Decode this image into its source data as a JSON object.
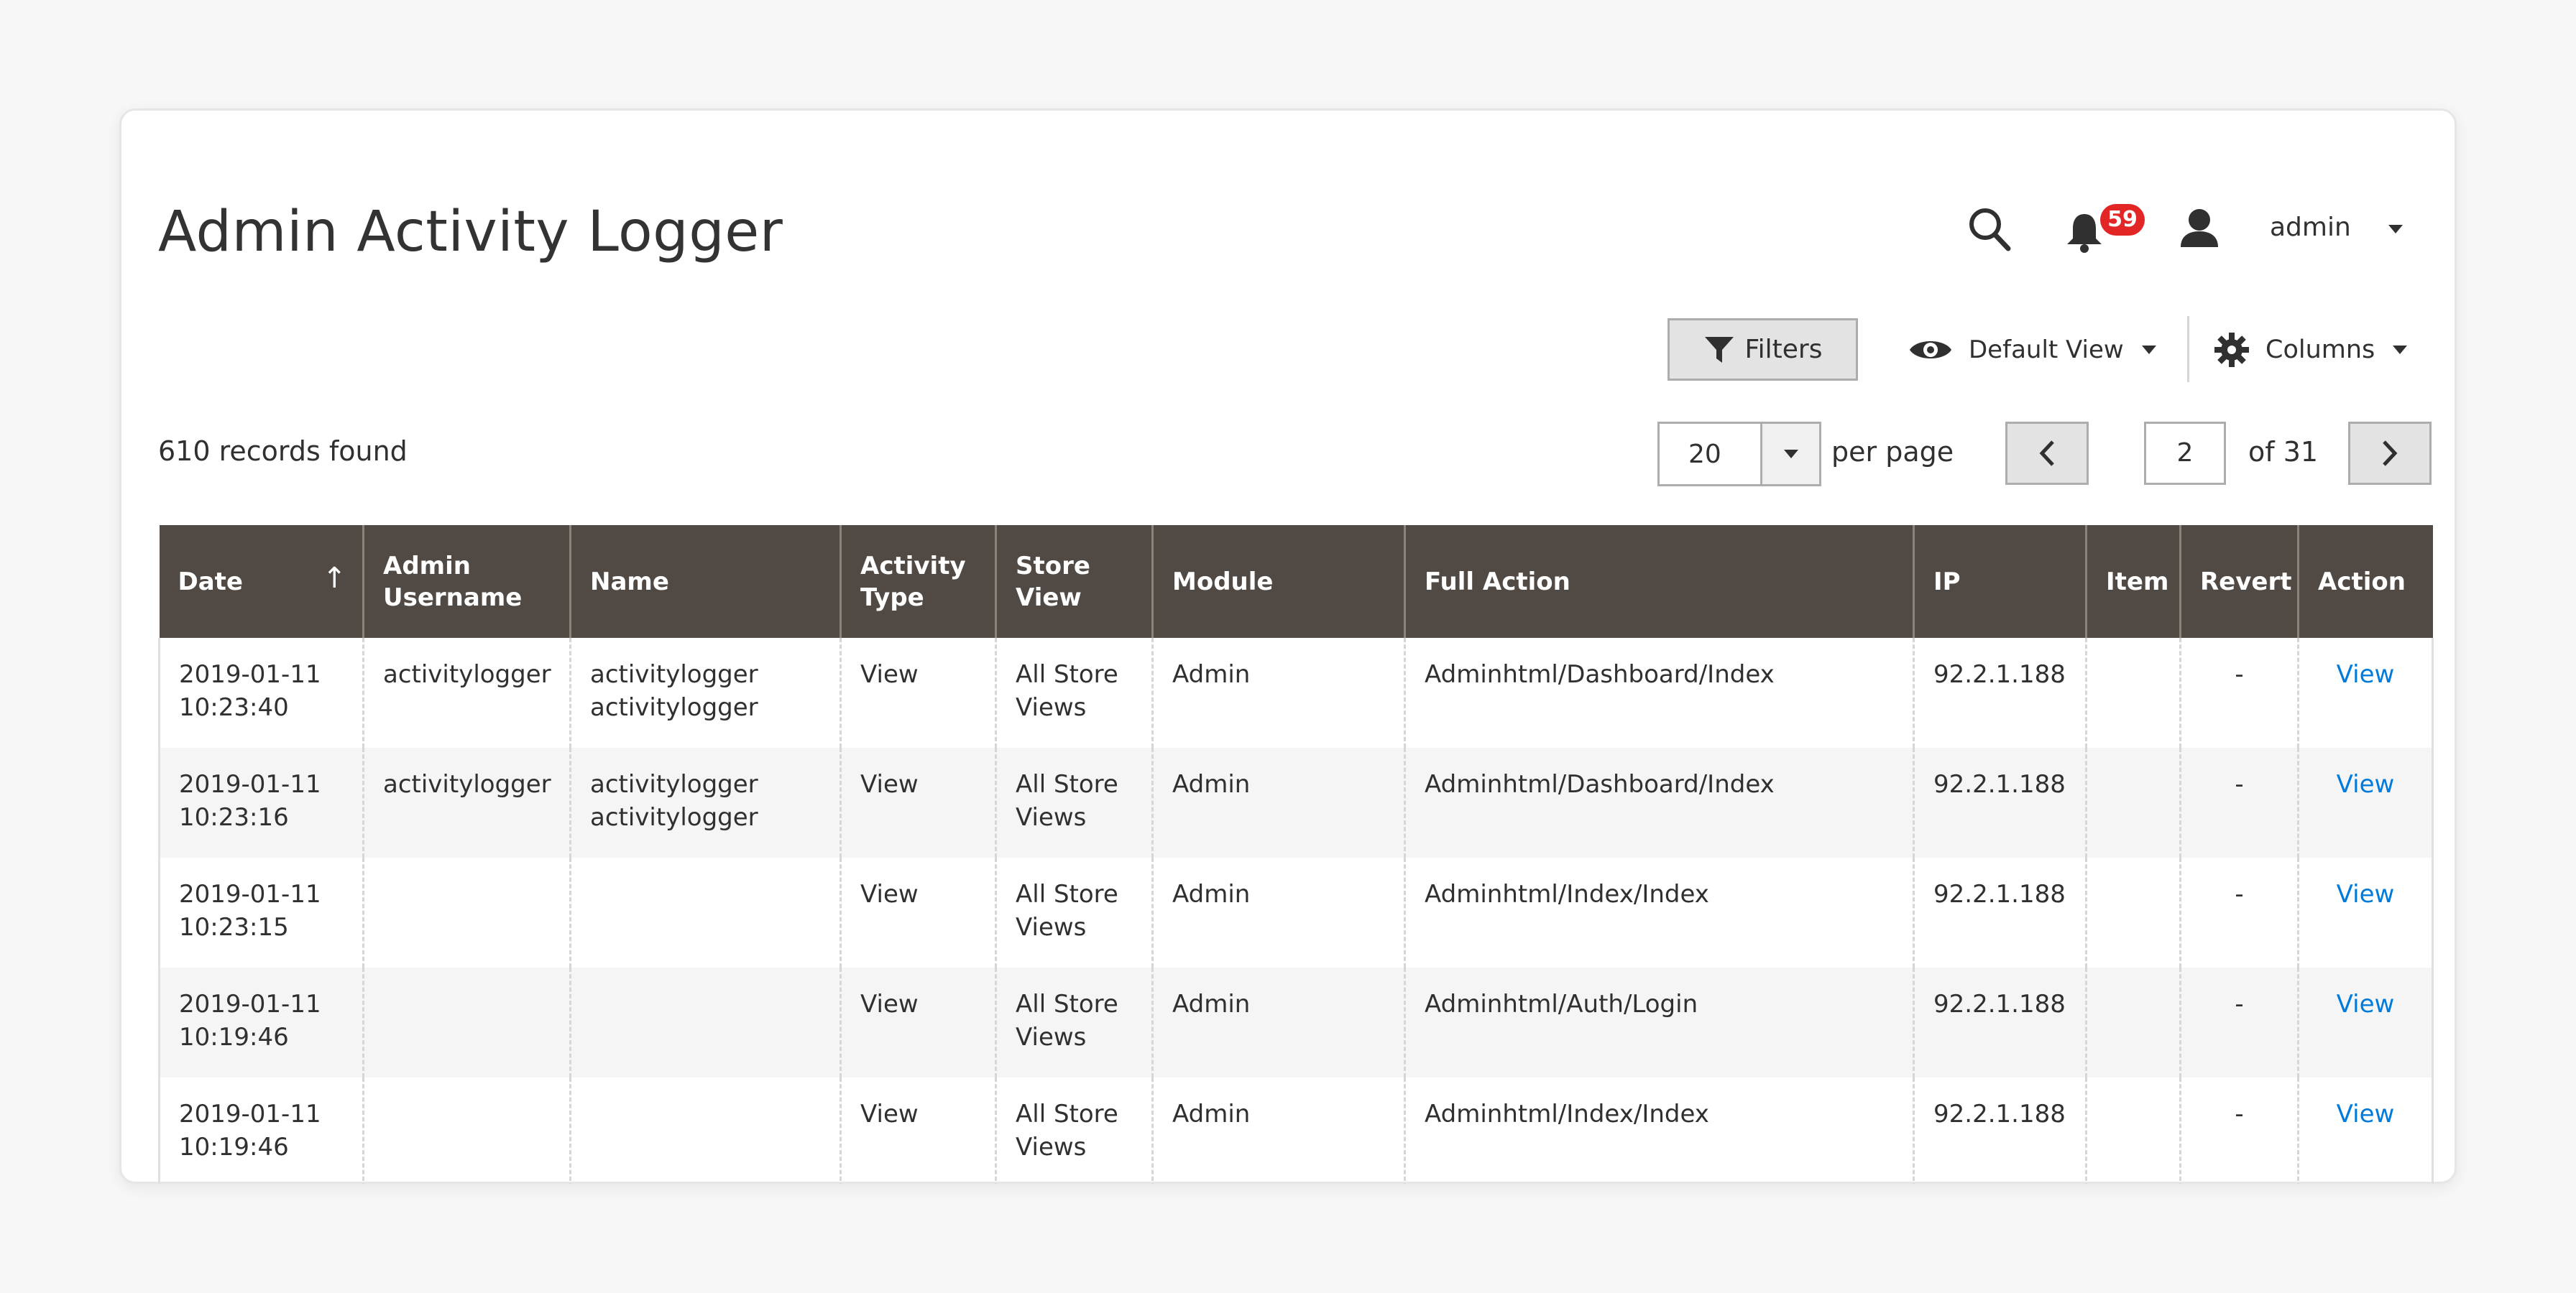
{
  "page": {
    "title": "Admin Activity Logger"
  },
  "header": {
    "notifications_count": "59",
    "user_name": "admin"
  },
  "toolbar": {
    "filters_label": "Filters",
    "view_label": "Default View",
    "columns_label": "Columns"
  },
  "records": {
    "text": "610 records found"
  },
  "pagination": {
    "per_page_value": "20",
    "per_page_label": "per page",
    "current_page": "2",
    "of_label": "of 31"
  },
  "grid": {
    "columns": [
      "Date",
      "Admin\nUsername",
      "Name",
      "Activity\nType",
      "Store\nView",
      "Module",
      "Full Action",
      "IP",
      "Item",
      "Revert",
      "Action"
    ],
    "rows": [
      {
        "date": "2019-01-11\n10:23:40",
        "username": "activitylogger",
        "name": "activitylogger\nactivitylogger",
        "type": "View",
        "store": "All Store\nViews",
        "module": "Admin",
        "action": "Adminhtml/Dashboard/Index",
        "ip": "92.2.1.188",
        "item": "",
        "revert": "-",
        "link": "View"
      },
      {
        "date": "2019-01-11\n10:23:16",
        "username": "activitylogger",
        "name": "activitylogger\nactivitylogger",
        "type": "View",
        "store": "All Store\nViews",
        "module": "Admin",
        "action": "Adminhtml/Dashboard/Index",
        "ip": "92.2.1.188",
        "item": "",
        "revert": "-",
        "link": "View"
      },
      {
        "date": "2019-01-11\n10:23:15",
        "username": "",
        "name": "",
        "type": "View",
        "store": "All Store\nViews",
        "module": "Admin",
        "action": "Adminhtml/Index/Index",
        "ip": "92.2.1.188",
        "item": "",
        "revert": "-",
        "link": "View"
      },
      {
        "date": "2019-01-11\n10:19:46",
        "username": "",
        "name": "",
        "type": "View",
        "store": "All Store\nViews",
        "module": "Admin",
        "action": "Adminhtml/Auth/Login",
        "ip": "92.2.1.188",
        "item": "",
        "revert": "-",
        "link": "View"
      },
      {
        "date": "2019-01-11\n10:19:46",
        "username": "",
        "name": "",
        "type": "View",
        "store": "All Store\nViews",
        "module": "Admin",
        "action": "Adminhtml/Index/Index",
        "ip": "92.2.1.188",
        "item": "",
        "revert": "-",
        "link": "View"
      }
    ]
  },
  "colors": {
    "header_bg": "#514943",
    "link": "#007bdb",
    "badge": "#e22626"
  }
}
